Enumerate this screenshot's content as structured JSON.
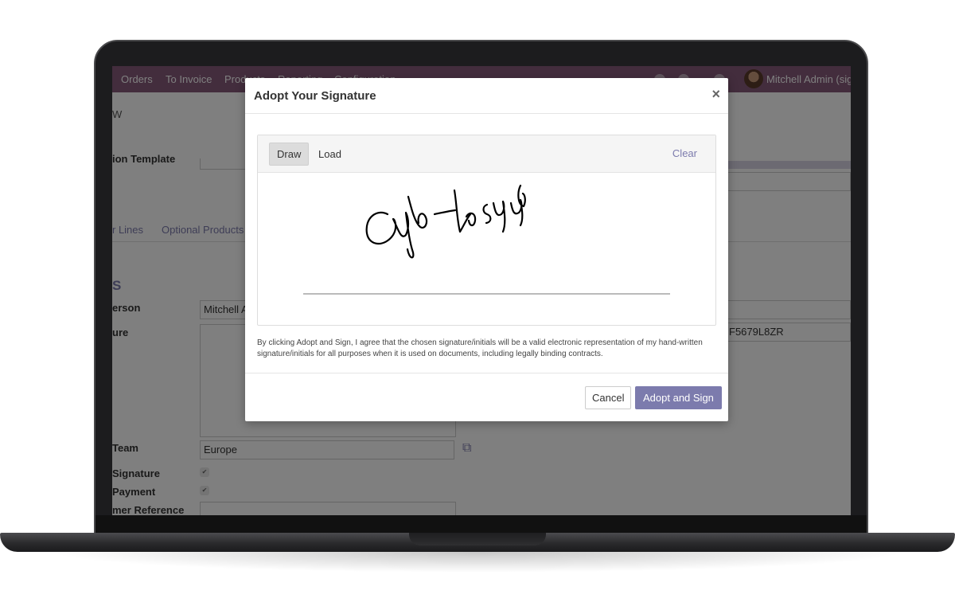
{
  "app": {
    "nav": {
      "items": [
        "Orders",
        "To Invoice",
        "Products",
        "Reporting",
        "Configuration"
      ],
      "user_name": "Mitchell Admin (sign"
    },
    "form": {
      "partial_title": "W",
      "quotation_template_label": "ion Template",
      "tabs": [
        "r Lines",
        "Optional Products"
      ],
      "section_heading": "S",
      "salesperson_label": "erson",
      "salesperson_value": "Mitchell A",
      "signature_label": "ure",
      "sales_team_label": "Team",
      "sales_team_value": "Europe",
      "online_signature_label": "Signature",
      "online_payment_label": "Payment",
      "customer_reference_label": "mer Reference",
      "reference_value": "F5679L8ZR"
    }
  },
  "modal": {
    "title": "Adopt Your Signature",
    "close": "×",
    "tabs": {
      "draw": "Draw",
      "load": "Load"
    },
    "clear": "Clear",
    "legal_text": "By clicking Adopt and Sign, I agree that the chosen signature/initials will be a valid electronic representation of my hand-written signature/initials for all purposes when it is used on documents, including legally binding contracts.",
    "buttons": {
      "cancel": "Cancel",
      "adopt": "Adopt and Sign"
    }
  },
  "colors": {
    "brand": "#875a7b",
    "accent": "#7c7bad"
  },
  "icons": {
    "close": "close-icon",
    "external_link": "external-link-icon",
    "checkbox": "checkbox-icon",
    "dropdown": "caret-down-icon"
  }
}
